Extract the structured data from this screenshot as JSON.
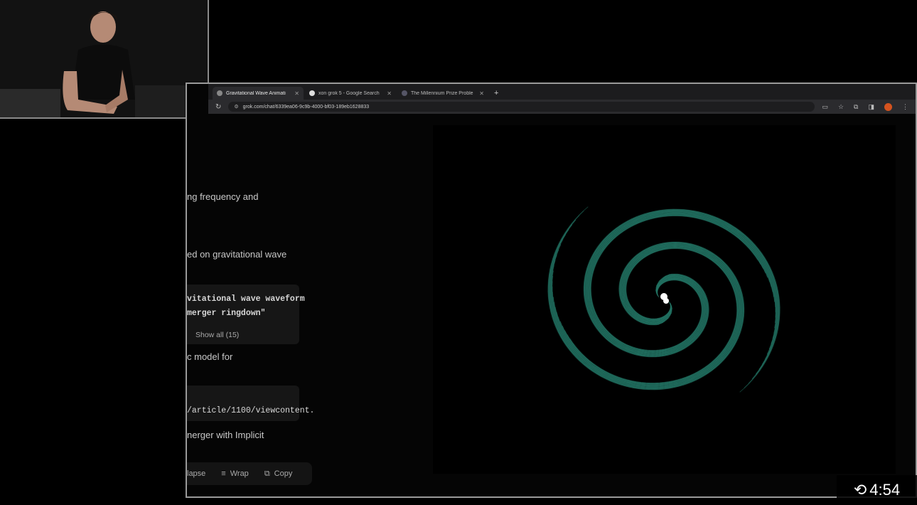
{
  "browser": {
    "tabs": [
      {
        "label": "Gravitational Wave Animati",
        "active": true
      },
      {
        "label": "xon grok 5 - Google Search",
        "active": false
      },
      {
        "label": "The Millennium Prize Proble",
        "active": false
      }
    ],
    "url": "grok.com/chat/6339ea06-9c9b-4000-bf03-189eb1628833",
    "colors": {
      "accent": "#2f9b86",
      "profile": "#d5531f"
    }
  },
  "chat": {
    "line1": "ng frequency and",
    "line2": "ed on gravitational wave",
    "code1_l1": "vitational wave waveform",
    "code1_l2": " merger ringdown\"",
    "show_all": "Show all (15)",
    "line3": "c model for",
    "code2": "/article/1100/viewcontent.",
    "line4": "nerger with Implicit",
    "collapse": "lapse",
    "wrap": "Wrap",
    "copy": "Copy"
  },
  "video": {
    "timestamp": "4:54"
  }
}
